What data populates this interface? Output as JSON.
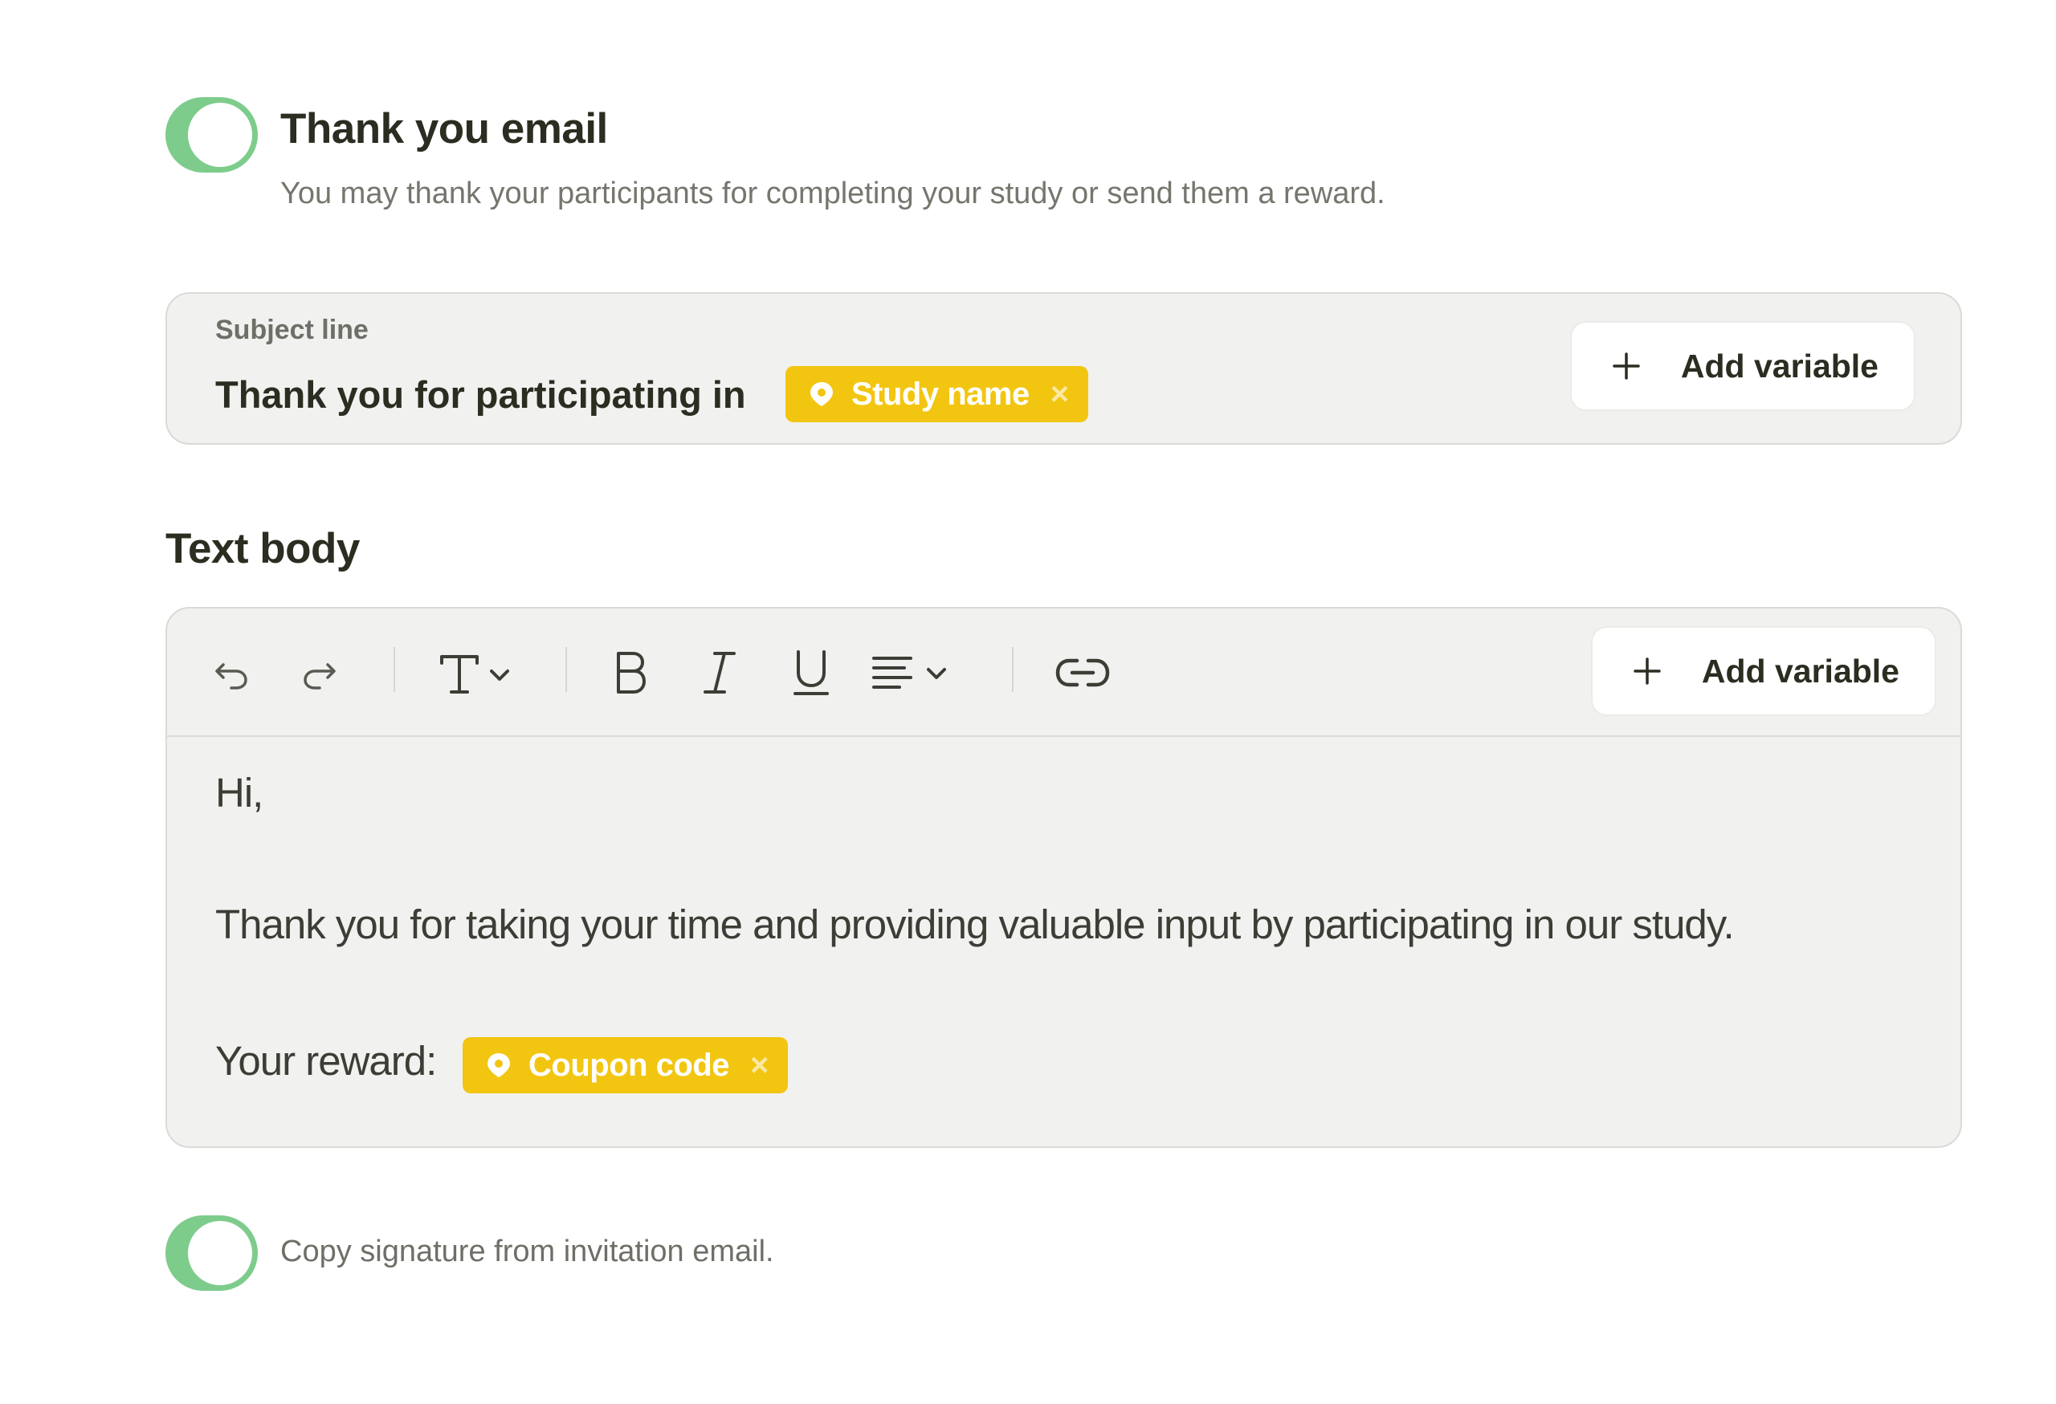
{
  "thank_you_email": {
    "enabled": true,
    "title": "Thank you email",
    "description": "You may thank your participants for completing your study or send them a reward."
  },
  "subject": {
    "label": "Subject line",
    "text": "Thank you for participating in",
    "variable": {
      "label": "Study name",
      "remove": "×"
    },
    "add_variable_label": "Add variable"
  },
  "text_body": {
    "heading": "Text body",
    "toolbar": {
      "icons": [
        "undo-icon",
        "redo-icon",
        "text-style-icon",
        "bold-icon",
        "italic-icon",
        "underline-icon",
        "align-icon",
        "link-icon"
      ],
      "add_variable_label": "Add variable"
    },
    "content": {
      "greeting": "Hi,",
      "paragraph": "Thank you for taking your time and providing valuable input by participating in our study.",
      "reward_label": "Your reward:",
      "reward_variable": {
        "label": "Coupon code",
        "remove": "×"
      }
    }
  },
  "signature": {
    "enabled": true,
    "label": "Copy signature from invitation email."
  },
  "colors": {
    "toggle_on": "#7dcc8c",
    "chip": "#f2c511",
    "panel_bg": "#f1f1ef",
    "text_dark": "#2a2d20"
  }
}
